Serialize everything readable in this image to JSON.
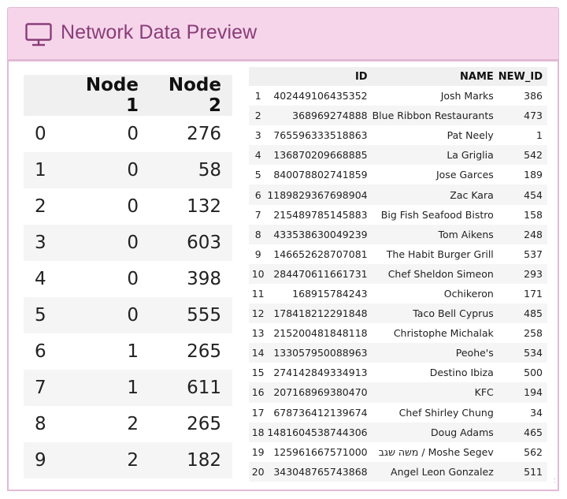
{
  "header": {
    "title": "Network Data Preview",
    "icon": "monitor-icon",
    "accent": "#8a3d78",
    "background": "#f6d5ea"
  },
  "edges_table": {
    "columns": [
      "",
      "Node 1",
      "Node 2"
    ],
    "rows": [
      {
        "index": "0",
        "node1": "0",
        "node2": "276"
      },
      {
        "index": "1",
        "node1": "0",
        "node2": "58"
      },
      {
        "index": "2",
        "node1": "0",
        "node2": "132"
      },
      {
        "index": "3",
        "node1": "0",
        "node2": "603"
      },
      {
        "index": "4",
        "node1": "0",
        "node2": "398"
      },
      {
        "index": "5",
        "node1": "0",
        "node2": "555"
      },
      {
        "index": "6",
        "node1": "1",
        "node2": "265"
      },
      {
        "index": "7",
        "node1": "1",
        "node2": "611"
      },
      {
        "index": "8",
        "node1": "2",
        "node2": "265"
      },
      {
        "index": "9",
        "node1": "2",
        "node2": "182"
      }
    ]
  },
  "nodes_table": {
    "columns": [
      "",
      "ID",
      "NAME",
      "NEW_ID"
    ],
    "rows": [
      {
        "row": "1",
        "id": "402449106435352",
        "name": "Josh Marks",
        "new_id": "386"
      },
      {
        "row": "2",
        "id": "368969274888",
        "name": "Blue Ribbon Restaurants",
        "new_id": "473"
      },
      {
        "row": "3",
        "id": "765596333518863",
        "name": "Pat Neely",
        "new_id": "1"
      },
      {
        "row": "4",
        "id": "136870209668885",
        "name": "La Griglia",
        "new_id": "542"
      },
      {
        "row": "5",
        "id": "840078802741859",
        "name": "Jose Garces",
        "new_id": "189"
      },
      {
        "row": "6",
        "id": "1189829367698904",
        "name": "Zac Kara",
        "new_id": "454"
      },
      {
        "row": "7",
        "id": "215489785145883",
        "name": "Big Fish Seafood Bistro",
        "new_id": "158"
      },
      {
        "row": "8",
        "id": "433538630049239",
        "name": "Tom Aikens",
        "new_id": "248"
      },
      {
        "row": "9",
        "id": "146652628707081",
        "name": "The Habit Burger Grill",
        "new_id": "537"
      },
      {
        "row": "10",
        "id": "284470611661731",
        "name": "Chef Sheldon Simeon",
        "new_id": "293"
      },
      {
        "row": "11",
        "id": "168915784243",
        "name": "Ochikeron",
        "new_id": "171"
      },
      {
        "row": "12",
        "id": "178418212291848",
        "name": "Taco Bell Cyprus",
        "new_id": "485"
      },
      {
        "row": "13",
        "id": "215200481848118",
        "name": "Christophe Michalak",
        "new_id": "258"
      },
      {
        "row": "14",
        "id": "133057950088963",
        "name": "Peohe's",
        "new_id": "534"
      },
      {
        "row": "15",
        "id": "274142849334913",
        "name": "Destino Ibiza",
        "new_id": "500"
      },
      {
        "row": "16",
        "id": "207168969380470",
        "name": "KFC",
        "new_id": "194"
      },
      {
        "row": "17",
        "id": "678736412139674",
        "name": "Chef Shirley Chung",
        "new_id": "34"
      },
      {
        "row": "18",
        "id": "1481604538744306",
        "name": "Doug Adams",
        "new_id": "465"
      },
      {
        "row": "19",
        "id": "125961667571000",
        "name": "משה שגב / Moshe Segev",
        "new_id": "562"
      },
      {
        "row": "20",
        "id": "343048765743868",
        "name": "Angel Leon Gonzalez",
        "new_id": "511"
      }
    ]
  },
  "scroll_indicator": ":"
}
